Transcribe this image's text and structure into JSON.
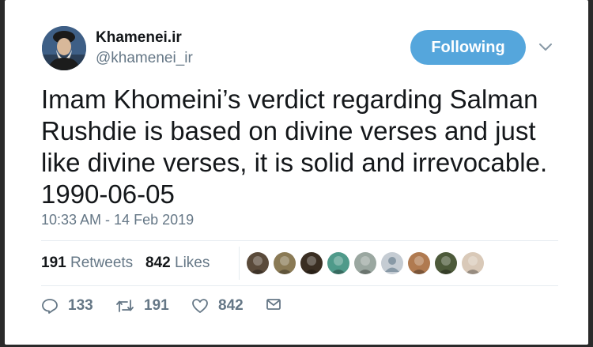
{
  "author": {
    "name": "Khamenei.ir",
    "handle": "@khamenei_ir",
    "avatar_icon": "profile-photo"
  },
  "follow_button": {
    "label": "Following",
    "color": "#55a6dc"
  },
  "menu_icon": "chevron-down-icon",
  "tweet": {
    "text": "Imam Khomeini’s verdict regarding Salman Rushdie is based on divine verses and just like divine verses, it is solid and irrevocable. 1990-06-05",
    "timestamp": "10:33 AM - 14 Feb 2019"
  },
  "stats": {
    "retweets_count": "191",
    "retweets_label": "Retweets",
    "likes_count": "842",
    "likes_label": "Likes"
  },
  "likers": [
    {
      "icon": "liker-avatar-1",
      "color": "#5a4a3a"
    },
    {
      "icon": "liker-avatar-2",
      "color": "#8a7a55"
    },
    {
      "icon": "liker-avatar-3",
      "color": "#3a2e22"
    },
    {
      "icon": "liker-avatar-4",
      "color": "#4f9a8a"
    },
    {
      "icon": "liker-avatar-5",
      "color": "#9aa7a0"
    },
    {
      "icon": "liker-avatar-default",
      "color": "#c5ccd3"
    },
    {
      "icon": "liker-avatar-7",
      "color": "#b07a50"
    },
    {
      "icon": "liker-avatar-8",
      "color": "#4d5a3a"
    },
    {
      "icon": "liker-avatar-9",
      "color": "#d9c9b8"
    }
  ],
  "actions": {
    "reply_count": "133",
    "retweet_count": "191",
    "like_count": "842"
  }
}
